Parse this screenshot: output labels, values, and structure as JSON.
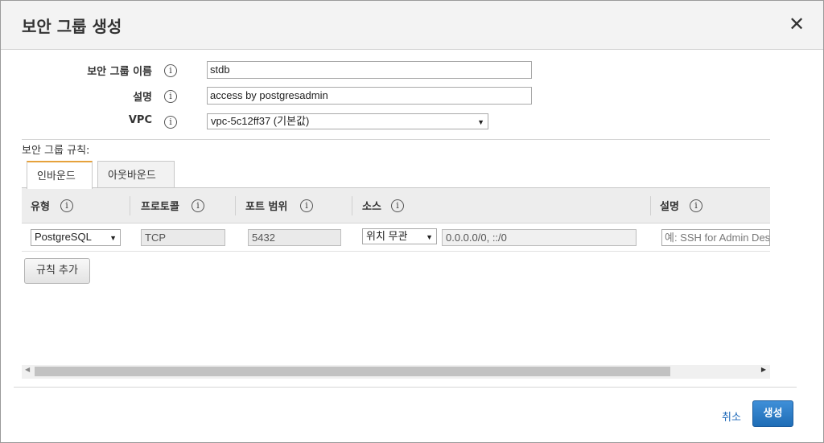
{
  "dialog": {
    "title": "보안 그룹 생성",
    "close_glyph": "✕"
  },
  "form": {
    "name_label": "보안 그룹 이름",
    "name_value": "stdb",
    "description_label": "설명",
    "description_value": "access by postgresadmin",
    "vpc_label": "VPC",
    "vpc_value": "vpc-5c12ff37 (기본값)",
    "info_glyph": "i"
  },
  "rules": {
    "section_label": "보안 그룹 규칙:",
    "tabs": [
      {
        "label": "인바운드",
        "active": true
      },
      {
        "label": "아웃바운드",
        "active": false
      }
    ],
    "columns": [
      "유형",
      "프로토콜",
      "포트 범위",
      "소스",
      "설명"
    ],
    "row": {
      "type": "PostgreSQL",
      "protocol": "TCP",
      "port_range": "5432",
      "source_select": "위치 무관",
      "source_value": "0.0.0.0/0, ::/0",
      "description_placeholder": "예: SSH for Admin Desktop"
    },
    "add_rule_label": "규칙 추가"
  },
  "footer": {
    "cancel_label": "취소",
    "create_label": "생성"
  },
  "colors": {
    "accent_tab": "#e6a23c",
    "primary_button": "#2a7ac6",
    "link": "#1a66b8"
  }
}
